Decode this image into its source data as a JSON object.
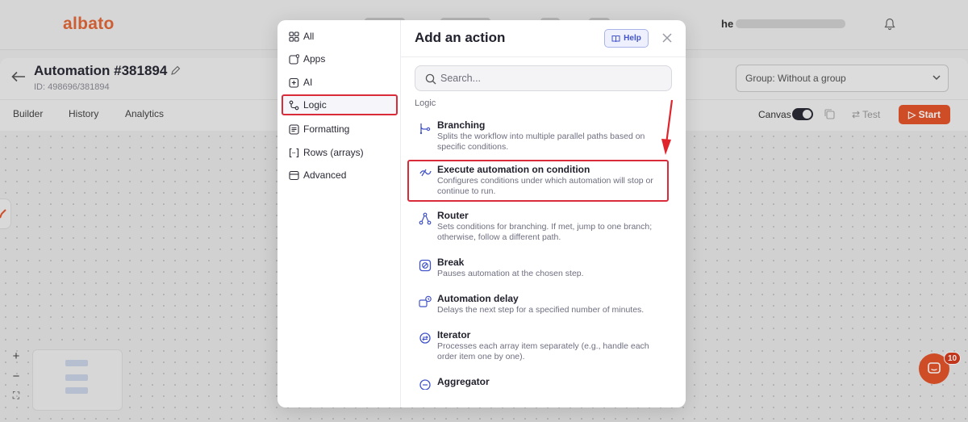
{
  "app": {
    "logo": "albato",
    "user_prefix": "he"
  },
  "automation": {
    "title": "Automation #381894",
    "id_text": "ID: 498696/381894"
  },
  "tabs": [
    "Builder",
    "History",
    "Analytics"
  ],
  "group_select": {
    "value": "Group: Without a group"
  },
  "toolbar": {
    "canvas_label": "Canvas",
    "canvas_on": true,
    "test_label": "Test",
    "start_label": "Start"
  },
  "chat": {
    "badge": "10"
  },
  "modal": {
    "title": "Add an action",
    "help_label": "Help",
    "search_placeholder": "Search...",
    "section_label": "Logic",
    "categories": [
      {
        "label": "All",
        "icon": "grid-icon"
      },
      {
        "label": "Apps",
        "icon": "apps-icon"
      },
      {
        "label": "AI",
        "icon": "ai-sparkle-icon"
      },
      {
        "label": "Logic",
        "icon": "logic-icon",
        "active": true
      },
      {
        "label": "Formatting",
        "icon": "formatting-icon"
      },
      {
        "label": "Rows (arrays)",
        "icon": "brackets-icon"
      },
      {
        "label": "Advanced",
        "icon": "advanced-icon"
      }
    ],
    "items": [
      {
        "title": "Branching",
        "desc": "Splits the workflow into multiple parallel paths based on specific conditions.",
        "icon": "branching-icon"
      },
      {
        "title": "Execute automation on condition",
        "desc": "Configures conditions under which automation will stop or continue to run.",
        "icon": "condition-icon",
        "highlight": true
      },
      {
        "title": "Router",
        "desc": "Sets conditions for branching. If met, jump to one branch; otherwise, follow a different path.",
        "icon": "router-icon"
      },
      {
        "title": "Break",
        "desc": "Pauses automation at the chosen step.",
        "icon": "break-icon"
      },
      {
        "title": "Automation delay",
        "desc": "Delays the next step for a specified number of minutes.",
        "icon": "delay-icon"
      },
      {
        "title": "Iterator",
        "desc": "Processes each array item separately (e.g., handle each order item one by one).",
        "icon": "iterator-icon"
      },
      {
        "title": "Aggregator",
        "desc": "",
        "icon": "aggregator-icon"
      }
    ]
  },
  "colors": {
    "accent": "#e3552a",
    "highlight_border": "#d92b3a",
    "link_blue": "#4253c9"
  }
}
